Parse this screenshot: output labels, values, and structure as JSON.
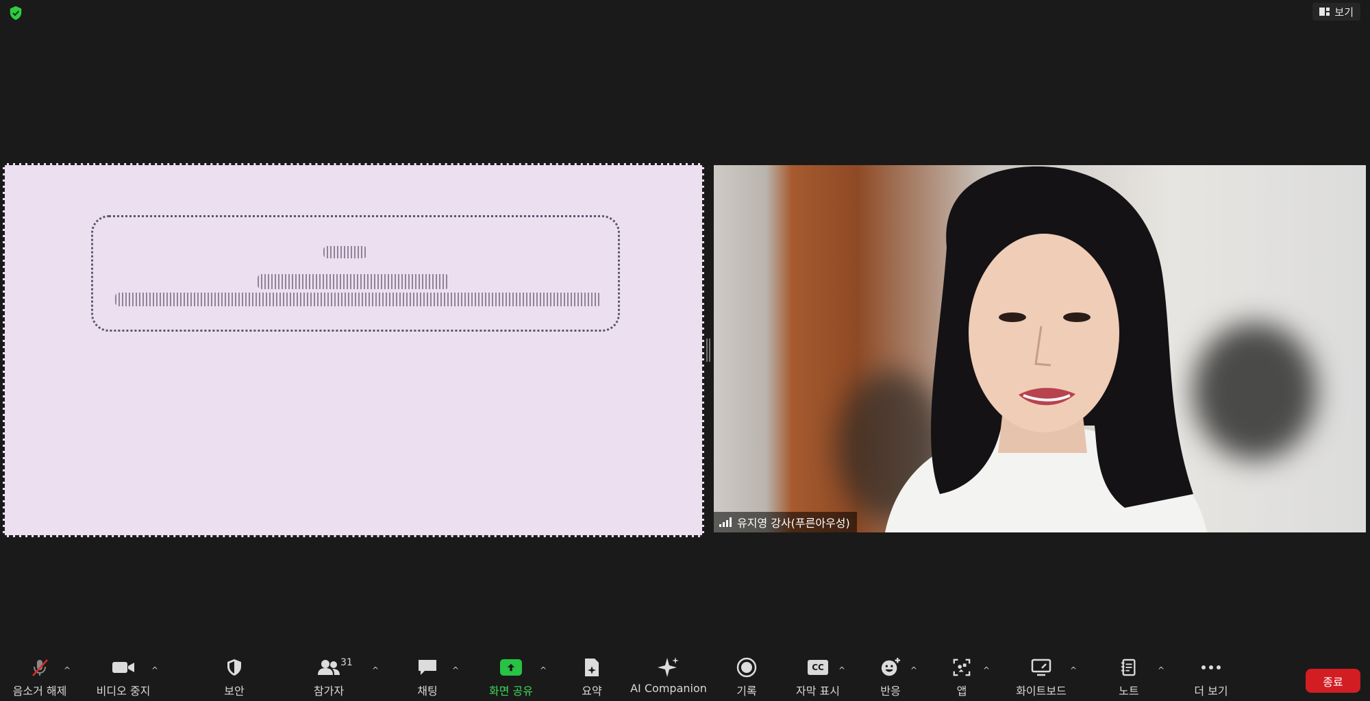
{
  "top_bar": {
    "view_label": "보기"
  },
  "video": {
    "participant_name": "유지영 강사(푸른아우성)"
  },
  "toolbar": {
    "mute_label": "음소거 해제",
    "video_label": "비디오 중지",
    "security_label": "보안",
    "participants_label": "참가자",
    "participants_count": "31",
    "chat_label": "채팅",
    "share_label": "화면 공유",
    "summary_label": "요약",
    "ai_label": "AI Companion",
    "record_label": "기록",
    "captions_label": "자막 표시",
    "cc_text": "CC",
    "reactions_label": "반응",
    "apps_label": "앱",
    "whiteboard_label": "화이트보드",
    "notes_label": "노트",
    "more_label": "더 보기",
    "end_label": "종료"
  },
  "colors": {
    "share_accent": "#28c244",
    "end_button": "#d21d23",
    "encryption_shield": "#2ecc40"
  }
}
